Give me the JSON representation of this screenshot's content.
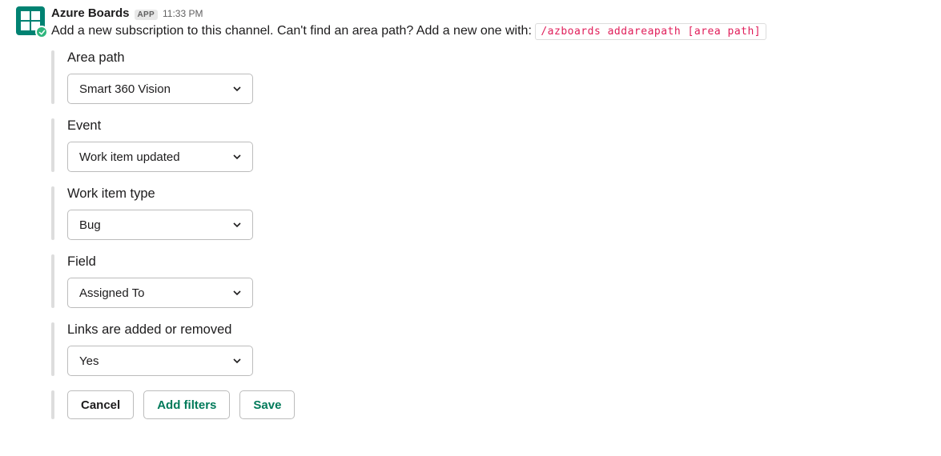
{
  "sender": {
    "name": "Azure Boards",
    "badge": "APP",
    "time": "11:33 PM"
  },
  "intro": {
    "text": "Add a new subscription to this channel. Can't find an area path? Add a new one with: ",
    "code": "/azboards addareapath [area path]"
  },
  "fields": {
    "area_path": {
      "label": "Area path",
      "value": "Smart 360 Vision"
    },
    "event": {
      "label": "Event",
      "value": "Work item updated"
    },
    "work_item_type": {
      "label": "Work item type",
      "value": "Bug"
    },
    "field": {
      "label": "Field",
      "value": "Assigned To"
    },
    "links": {
      "label": "Links are added or removed",
      "value": "Yes"
    }
  },
  "actions": {
    "cancel": "Cancel",
    "add_filters": "Add filters",
    "save": "Save"
  }
}
